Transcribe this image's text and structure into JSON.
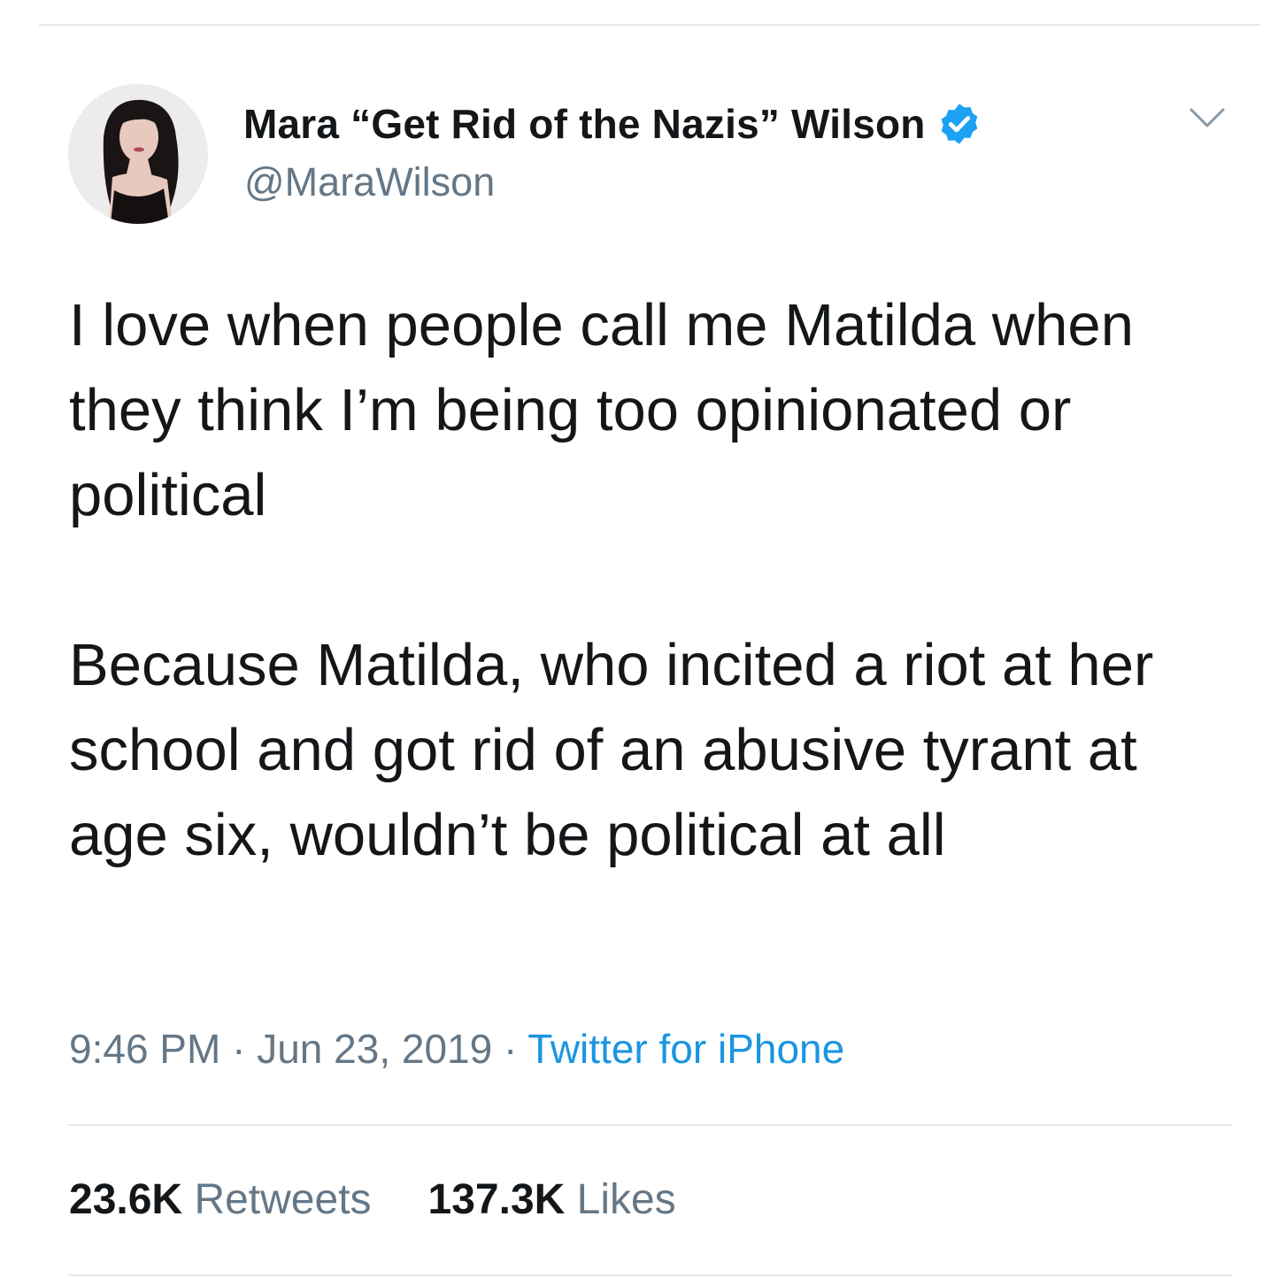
{
  "tweet": {
    "display_name": "Mara “Get Rid of the Nazis” Wilson",
    "handle": "@MaraWilson",
    "verified": true,
    "paragraphs": [
      "I love when people call me Matilda when they think I’m being too opinionated or political",
      "Because Matilda, who incited a riot at her school and got rid of an abusive tyrant at age six, wouldn’t be political at all"
    ],
    "time": "9:46 PM",
    "separator": " · ",
    "date": "Jun 23, 2019",
    "source": "Twitter for iPhone",
    "retweets": {
      "count": "23.6K",
      "label": "Retweets"
    },
    "likes": {
      "count": "137.3K",
      "label": "Likes"
    }
  },
  "icons": {
    "verified": "verified-badge-icon",
    "menu": "chevron-down-icon"
  },
  "colors": {
    "text": "#14171a",
    "secondary": "#657786",
    "link": "#1b95e0",
    "verified": "#1da1f2",
    "divider": "#e1e8ed"
  }
}
